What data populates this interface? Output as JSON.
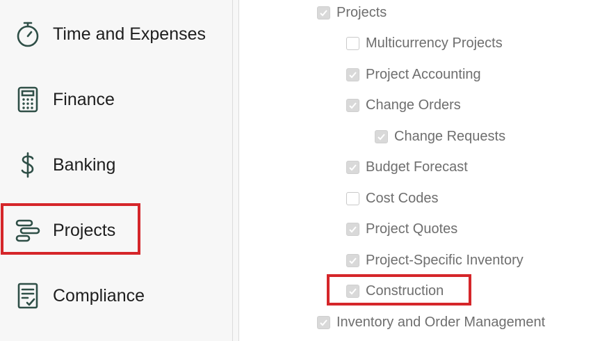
{
  "sidebar": {
    "items": [
      {
        "label": "Time and Expenses",
        "icon": "stopwatch-icon"
      },
      {
        "label": "Finance",
        "icon": "calculator-icon"
      },
      {
        "label": "Banking",
        "icon": "dollar-sign-icon"
      },
      {
        "label": "Projects",
        "icon": "gantt-chart-icon",
        "highlighted": true
      },
      {
        "label": "Compliance",
        "icon": "checklist-icon"
      }
    ]
  },
  "features": {
    "items": [
      {
        "label": "Projects",
        "checked": true
      },
      {
        "label": "Multicurrency Projects",
        "checked": false
      },
      {
        "label": "Project Accounting",
        "checked": true
      },
      {
        "label": "Change Orders",
        "checked": true
      },
      {
        "label": "Change Requests",
        "checked": true
      },
      {
        "label": "Budget Forecast",
        "checked": true
      },
      {
        "label": "Cost Codes",
        "checked": false
      },
      {
        "label": "Project Quotes",
        "checked": true
      },
      {
        "label": "Project-Specific Inventory",
        "checked": true
      },
      {
        "label": "Construction",
        "checked": true,
        "highlighted": true
      },
      {
        "label": "Inventory and Order Management",
        "checked": true
      }
    ]
  },
  "colors": {
    "highlight": "#d5262a",
    "icon": "#2f4f47",
    "checkbox_checked": "#d9d9d9"
  }
}
